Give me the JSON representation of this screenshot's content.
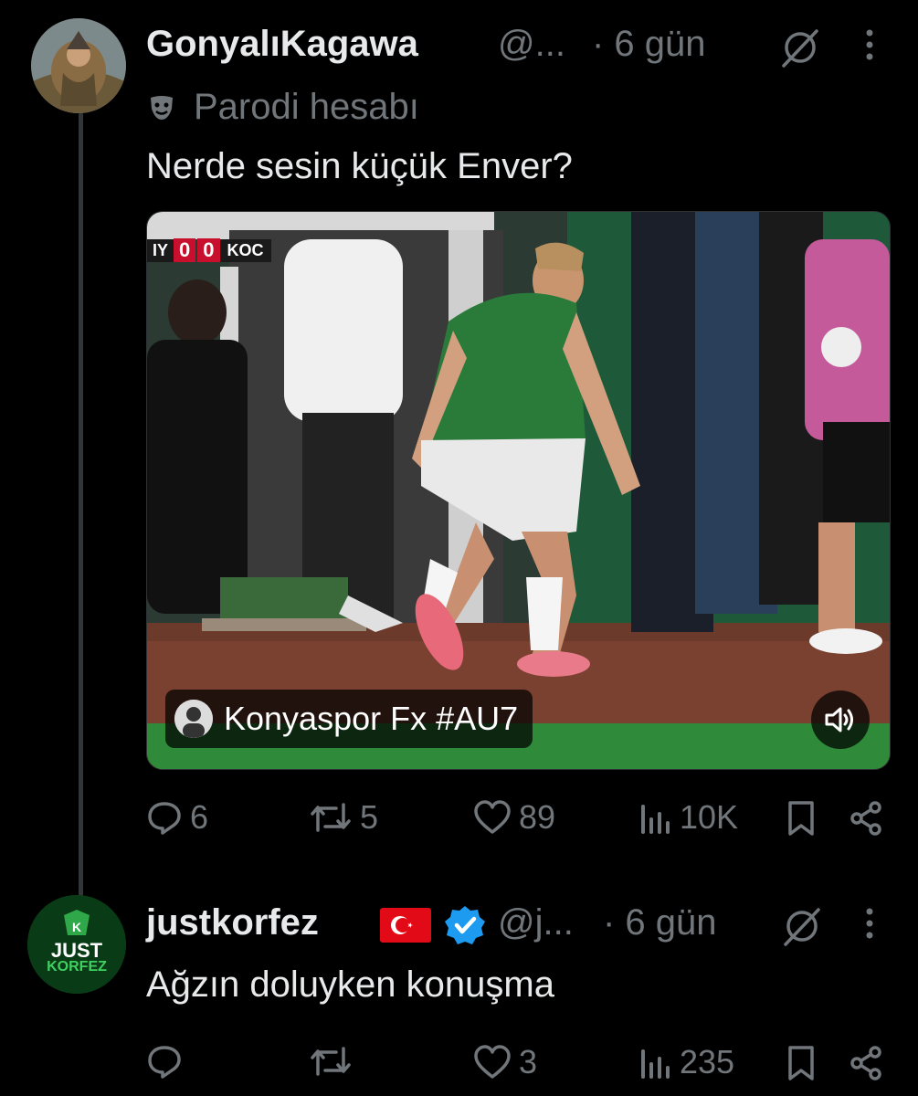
{
  "tweet1": {
    "display_name": "GonyalıKagawa",
    "handle": "@...",
    "time": "· 6 gün",
    "label": "Parodi hesabı",
    "text": "Nerde sesin küçük Enver?",
    "media": {
      "scoreboard_left": "IY",
      "score_home": "0",
      "score_away": "0",
      "scoreboard_right": "KOC",
      "attribution": "Konyaspor Fx #AU7"
    },
    "stats": {
      "replies": "6",
      "reposts": "5",
      "likes": "89",
      "views": "10K"
    }
  },
  "tweet2": {
    "display_name": "justkorfez",
    "avatar_text_1": "JUST",
    "avatar_text_2": "KORFEZ",
    "handle": "@j...",
    "time": "· 6 gün",
    "text": "Ağzın doluyken konuşma",
    "stats": {
      "replies": "",
      "reposts": "",
      "likes": "3",
      "views": "235"
    }
  },
  "icons": [
    "grok-icon",
    "more-icon",
    "parody-mask-icon",
    "reply-icon",
    "repost-icon",
    "like-icon",
    "views-icon",
    "bookmark-icon",
    "share-icon",
    "volume-icon",
    "verified-icon",
    "turkey-flag-icon"
  ],
  "colors": {
    "background": "#000000",
    "text": "#e7e9ea",
    "muted": "#71767b",
    "verified": "#1d9bf0",
    "flag": "#e30a17"
  }
}
